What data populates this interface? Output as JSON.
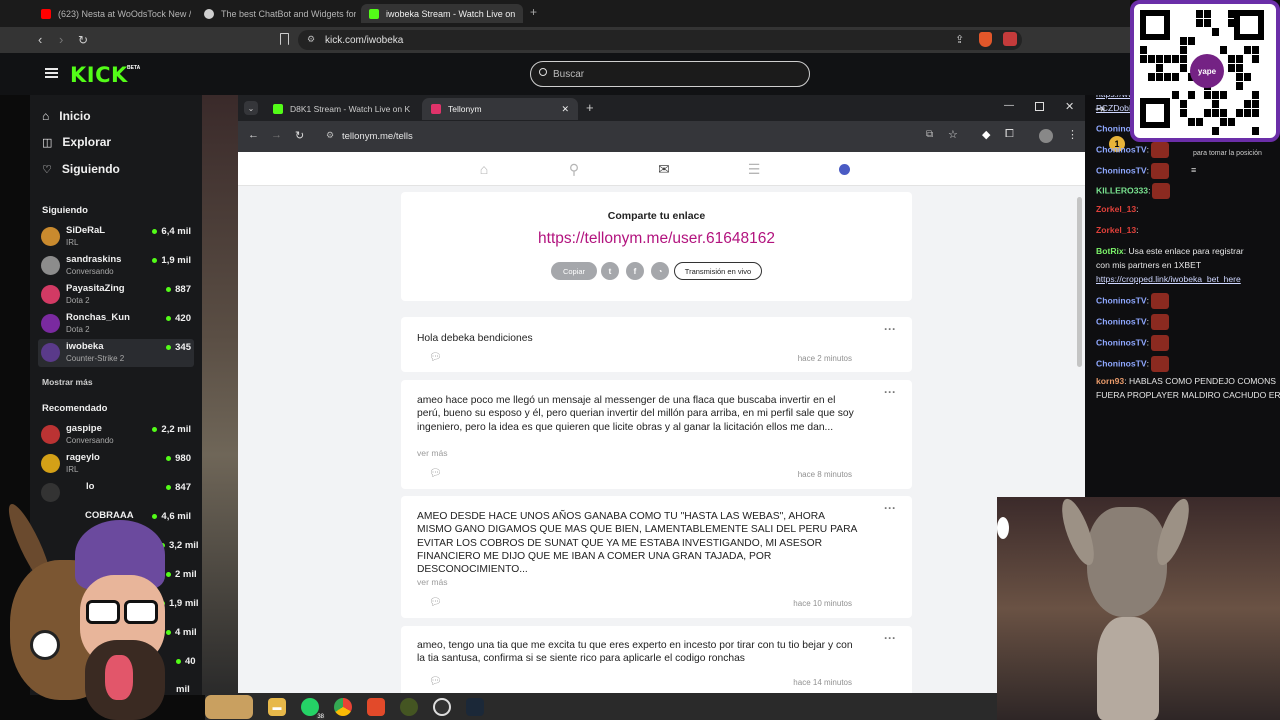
{
  "outer_browser": {
    "tabs": [
      {
        "title": "(623) Nesta at WoOdsTock New /",
        "favicon_color": "#ff0000"
      },
      {
        "title": "The best ChatBot and Widgets for Ki",
        "favicon_color": "#cfcfcf"
      },
      {
        "title": "iwobeka Stream - Watch Live on",
        "favicon_color": "#53fc18"
      }
    ],
    "new_tab": "+",
    "url": "kick.com/iwobeka"
  },
  "kick": {
    "logo": "KICK",
    "beta": "BETA",
    "search_placeholder": "Buscar",
    "nav": [
      {
        "label": "Inicio",
        "icon": "home-icon"
      },
      {
        "label": "Explorar",
        "icon": "compass-icon"
      },
      {
        "label": "Siguiendo",
        "icon": "heart-icon"
      }
    ],
    "following_title": "Siguiendo",
    "following": [
      {
        "name": "SiDeRaL",
        "category": "IRL",
        "viewers": "6,4 mil",
        "color": "#c98a2e"
      },
      {
        "name": "sandraskins",
        "category": "Conversando",
        "viewers": "1,9 mil",
        "color": "#8c8c8c"
      },
      {
        "name": "PayasitaZing",
        "category": "Dota 2",
        "viewers": "887",
        "color": "#d23a64"
      },
      {
        "name": "Ronchas_Kun",
        "category": "Dota 2",
        "viewers": "420",
        "color": "#7a2aa0"
      },
      {
        "name": "iwobeka",
        "category": "Counter-Strike 2",
        "viewers": "345",
        "color": "#5a3a8a"
      }
    ],
    "show_more": "Mostrar más",
    "recommended_title": "Recomendado",
    "recommended": [
      {
        "name": "gaspipe",
        "category": "Conversando",
        "viewers": "2,2 mil",
        "color": "#b33"
      },
      {
        "name": "rageylo",
        "category": "IRL",
        "viewers": "980",
        "color": "#d4a017"
      },
      {
        "name": "lo",
        "category": "",
        "viewers": "847",
        "color": "#333"
      },
      {
        "name": "COBRAAA",
        "category": "",
        "viewers": "4,6 mil",
        "color": "#555"
      }
    ],
    "partial_viewers": [
      "3,2 mil",
      "2 mil",
      "1,9 mil",
      "4 mil",
      "40",
      "mil"
    ]
  },
  "inner_browser": {
    "tabs": [
      {
        "title": "D8K1 Stream - Watch Live on K",
        "favicon_color": "#53fc18"
      },
      {
        "title": "Tellonym",
        "favicon_color": "#e0336a"
      }
    ],
    "url": "tellonym.me/tells"
  },
  "tellonym": {
    "nav_icons": [
      "home-icon",
      "search-icon",
      "inbox-icon",
      "feed-icon",
      "profile-icon"
    ],
    "share_title": "Comparte tu enlace",
    "share_link": "https://tellonym.me/user.61648162",
    "copy_label": "Copiar",
    "live_label": "Transmisión en vivo",
    "tells": [
      {
        "text": "Hola debeka bendiciones",
        "more": "",
        "time": "hace 2 minutos"
      },
      {
        "text": "ameo hace poco me llegó un mensaje al messenger de una flaca que buscaba invertir en el perú, bueno su esposo y él, pero querian invertir del millón para arriba, en mi perfil sale que soy ingeniero, pero la idea es que quieren que licite obras y al ganar la licitación ellos me dan...",
        "more": "ver más",
        "time": "hace 8 minutos"
      },
      {
        "text": "AMEO DESDE HACE UNOS AÑOS GANABA COMO TU \"HASTA LAS WEBAS\", AHORA MISMO GANO DIGAMOS QUE MAS QUE BIEN, LAMENTABLEMENTE SALI DEL PERU PARA EVITAR LOS COBROS DE SUNAT QUE YA ME ESTABA INVESTIGANDO, MI ASESOR FINANCIERO ME DIJO QUE ME IBAN A COMER UNA GRAN TAJADA, POR DESCONOCIMIENTO...",
        "more": "ver más",
        "time": "hace 10 minutos"
      },
      {
        "text": "ameo, tengo una tia que me excita tu que eres experto en incesto por tirar con tu tio bejar y con la tia santusa, confirma  si se siente rico para aplicarle el codigo ronchas",
        "more": "",
        "time": "hace 14 minutos"
      }
    ]
  },
  "chat": {
    "top_rank": "1",
    "top_text": "para tomar la posición",
    "lines": [
      {
        "user": "",
        "text": "https://www.instagram.com/channel/AbYCm4",
        "type": "link"
      },
      {
        "user": "",
        "text": "PCZDobBGi/?igsh=eGlxbG5leDE0b2Ex",
        "type": "link"
      },
      {
        "user": "ChoninosTV",
        "text": ":",
        "color": "#8fa8ff",
        "emote": true
      },
      {
        "user": "ChoninosTV",
        "text": ":",
        "color": "#8fa8ff",
        "emote": true
      },
      {
        "user": "ChoninosTV",
        "text": ":",
        "color": "#8fa8ff",
        "emote": true
      },
      {
        "user": "KILLERO333",
        "text": ":",
        "color": "#79e38f",
        "emote": true
      },
      {
        "user": "Zorkel_13",
        "text": ":",
        "color": "#e0403a",
        "emote": false
      },
      {
        "user": "Zorkel_13",
        "text": ":",
        "color": "#e0403a",
        "emote": false
      },
      {
        "user": "BotRix",
        "text": ": Usa este enlace para registrar",
        "color": "#7cf36a",
        "emote": false
      },
      {
        "user": "",
        "text": "con mis partners en 1XBET",
        "type": "plain"
      },
      {
        "user": "",
        "text": "https://cropped.link/iwobeka_bet_here",
        "type": "link"
      },
      {
        "user": "ChoninosTV",
        "text": ":",
        "color": "#8fa8ff",
        "emote": true
      },
      {
        "user": "ChoninosTV",
        "text": ":",
        "color": "#8fa8ff",
        "emote": true
      },
      {
        "user": "ChoninosTV",
        "text": ":",
        "color": "#8fa8ff",
        "emote": true
      },
      {
        "user": "ChoninosTV",
        "text": ":",
        "color": "#8fa8ff",
        "emote": true
      },
      {
        "user": "korn93",
        "text": ": HABLAS COMO PENDEJO COMONS",
        "color": "#e89a6a",
        "emote": false
      },
      {
        "user": "",
        "text": "FUERA PROPLAYER MALDIRO CACHUDO ER",
        "type": "plain"
      }
    ]
  },
  "overlay": {
    "yape_label": "yape"
  },
  "taskbar": {
    "whatsapp_badge": "38"
  },
  "colors": {
    "kick_green": "#53fc18",
    "tellonym_pink": "#b2137e",
    "page_bg": "#f2f3f5"
  }
}
